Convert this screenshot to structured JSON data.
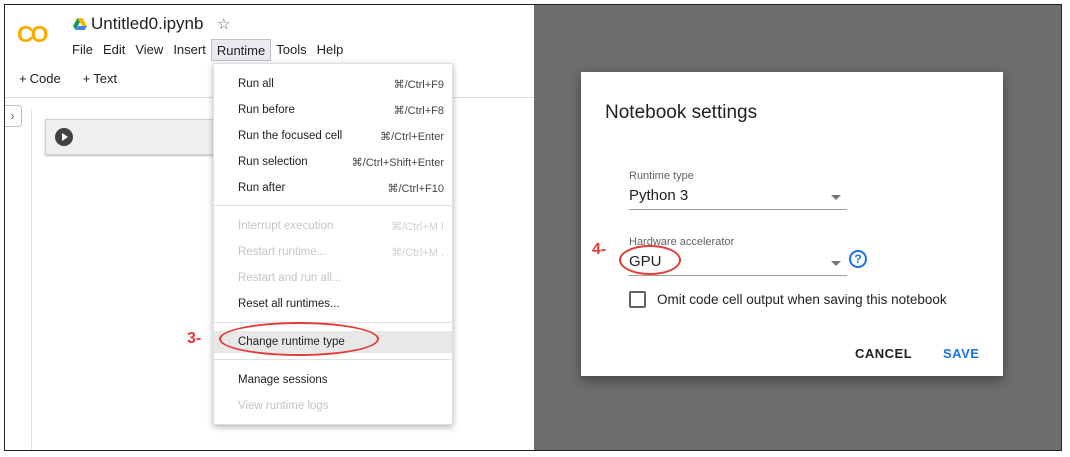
{
  "notebook": {
    "title": "Untitled0.ipynb",
    "logo": "CO"
  },
  "menubar": [
    "File",
    "Edit",
    "View",
    "Insert",
    "Runtime",
    "Tools",
    "Help"
  ],
  "toolbar": {
    "code": "Code",
    "text": "Text"
  },
  "runtime_menu": {
    "items": [
      {
        "label": "Run all",
        "shortcut": "⌘/Ctrl+F9"
      },
      {
        "label": "Run before",
        "shortcut": "⌘/Ctrl+F8"
      },
      {
        "label": "Run the focused cell",
        "shortcut": "⌘/Ctrl+Enter"
      },
      {
        "label": "Run selection",
        "shortcut": "⌘/Ctrl+Shift+Enter"
      },
      {
        "label": "Run after",
        "shortcut": "⌘/Ctrl+F10"
      },
      {
        "label": "Interrupt execution",
        "shortcut": "⌘/Ctrl+M I"
      },
      {
        "label": "Restart runtime...",
        "shortcut": "⌘/Ctrl+M ."
      },
      {
        "label": "Restart and run all...",
        "shortcut": ""
      },
      {
        "label": "Reset all runtimes...",
        "shortcut": ""
      },
      {
        "label": "Change runtime type",
        "shortcut": ""
      },
      {
        "label": "Manage sessions",
        "shortcut": ""
      },
      {
        "label": "View runtime logs",
        "shortcut": ""
      }
    ]
  },
  "annotations": {
    "step3": "3-",
    "step4": "4-"
  },
  "dialog": {
    "title": "Notebook settings",
    "runtime_type_label": "Runtime type",
    "runtime_type_value": "Python 3",
    "accelerator_label": "Hardware accelerator",
    "accelerator_value": "GPU",
    "help_symbol": "?",
    "checkbox_label": "Omit code cell output when saving this notebook",
    "cancel_label": "CANCEL",
    "save_label": "SAVE"
  },
  "colors": {
    "accent": "#1a73e8",
    "annotation": "#e53935",
    "overlay": "#6e6e6e"
  }
}
